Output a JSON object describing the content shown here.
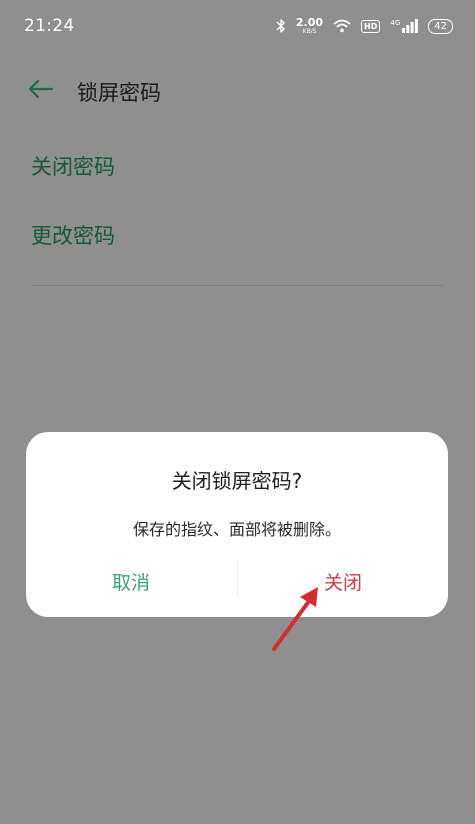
{
  "status_bar": {
    "time": "21:24",
    "speed_value": "2.00",
    "speed_unit": "KB/S",
    "hd_label": "HD",
    "network": "4G",
    "battery": "42"
  },
  "header": {
    "title": "锁屏密码"
  },
  "menu": {
    "items": [
      {
        "label": "关闭密码"
      },
      {
        "label": "更改密码"
      }
    ]
  },
  "dialog": {
    "title": "关闭锁屏密码?",
    "message": "保存的指纹、面部将被删除。",
    "cancel_label": "取消",
    "confirm_label": "关闭"
  },
  "colors": {
    "overlay_bg": "#8f8f8f",
    "menu_text": "#16593a",
    "cancel": "#3aa57a",
    "confirm": "#d13b3b",
    "annotation_arrow": "#d32f2f"
  }
}
